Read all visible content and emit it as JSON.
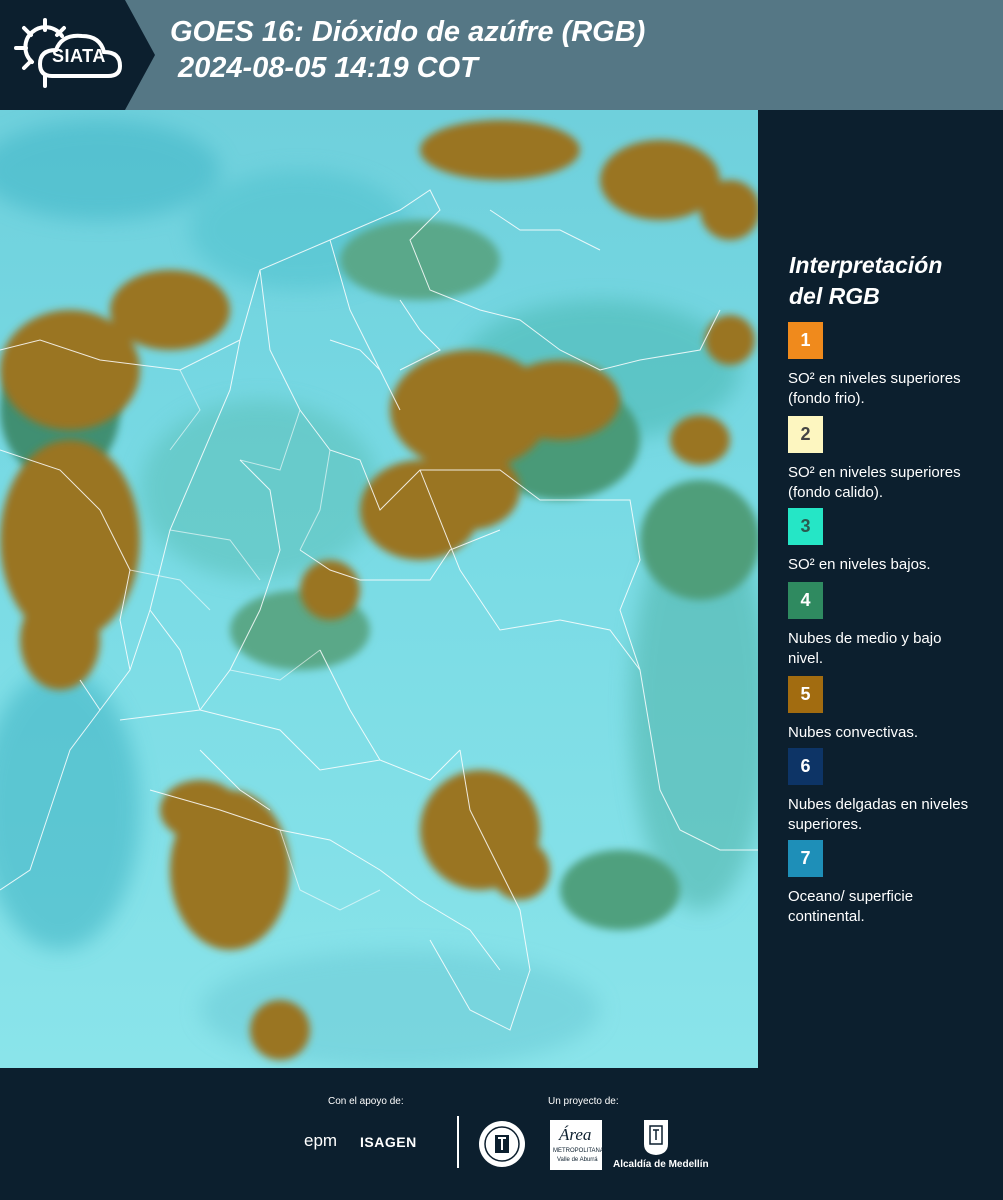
{
  "header": {
    "logo_text": "SIATA",
    "title_line1": "GOES 16: Dióxido de azúfre (RGB)",
    "title_line2": "2024-08-05 14:19 COT"
  },
  "legend": {
    "title_line1": "Interpretación",
    "title_line2": "del RGB",
    "items": [
      {
        "number": "1",
        "text": "SO² en niveles superiores (fondo frio).",
        "color": "#f08a1c",
        "number_color": "#ffffff"
      },
      {
        "number": "2",
        "text": "SO² en niveles superiores (fondo calido).",
        "color": "#fdf6c0",
        "number_color": "#444444"
      },
      {
        "number": "3",
        "text": "SO² en niveles bajos.",
        "color": "#25e6c6",
        "number_color": "#2a5a50"
      },
      {
        "number": "4",
        "text": "Nubes de medio y bajo nivel.",
        "color": "#2f8a60",
        "number_color": "#ffffff"
      },
      {
        "number": "5",
        "text": "Nubes convectivas.",
        "color": "#a26c10",
        "number_color": "#ffffff"
      },
      {
        "number": "6",
        "text": "Nubes delgadas en niveles superiores.",
        "color": "#0d3466",
        "number_color": "#ffffff"
      },
      {
        "number": "7",
        "text": "Oceano/ superficie continental.",
        "color": "#1e8fb8",
        "number_color": "#ffffff"
      }
    ]
  },
  "footer": {
    "support_label": "Con el apoyo de:",
    "project_label": "Un proyecto de:",
    "sponsor1": "epm",
    "sponsor2": "ISAGEN",
    "partner_area_main": "Área",
    "partner_area_sub1": "METROPOLITANA",
    "partner_area_sub2": "Valle de Aburrá",
    "partner_alcaldia": "Alcaldía de Medellín"
  }
}
